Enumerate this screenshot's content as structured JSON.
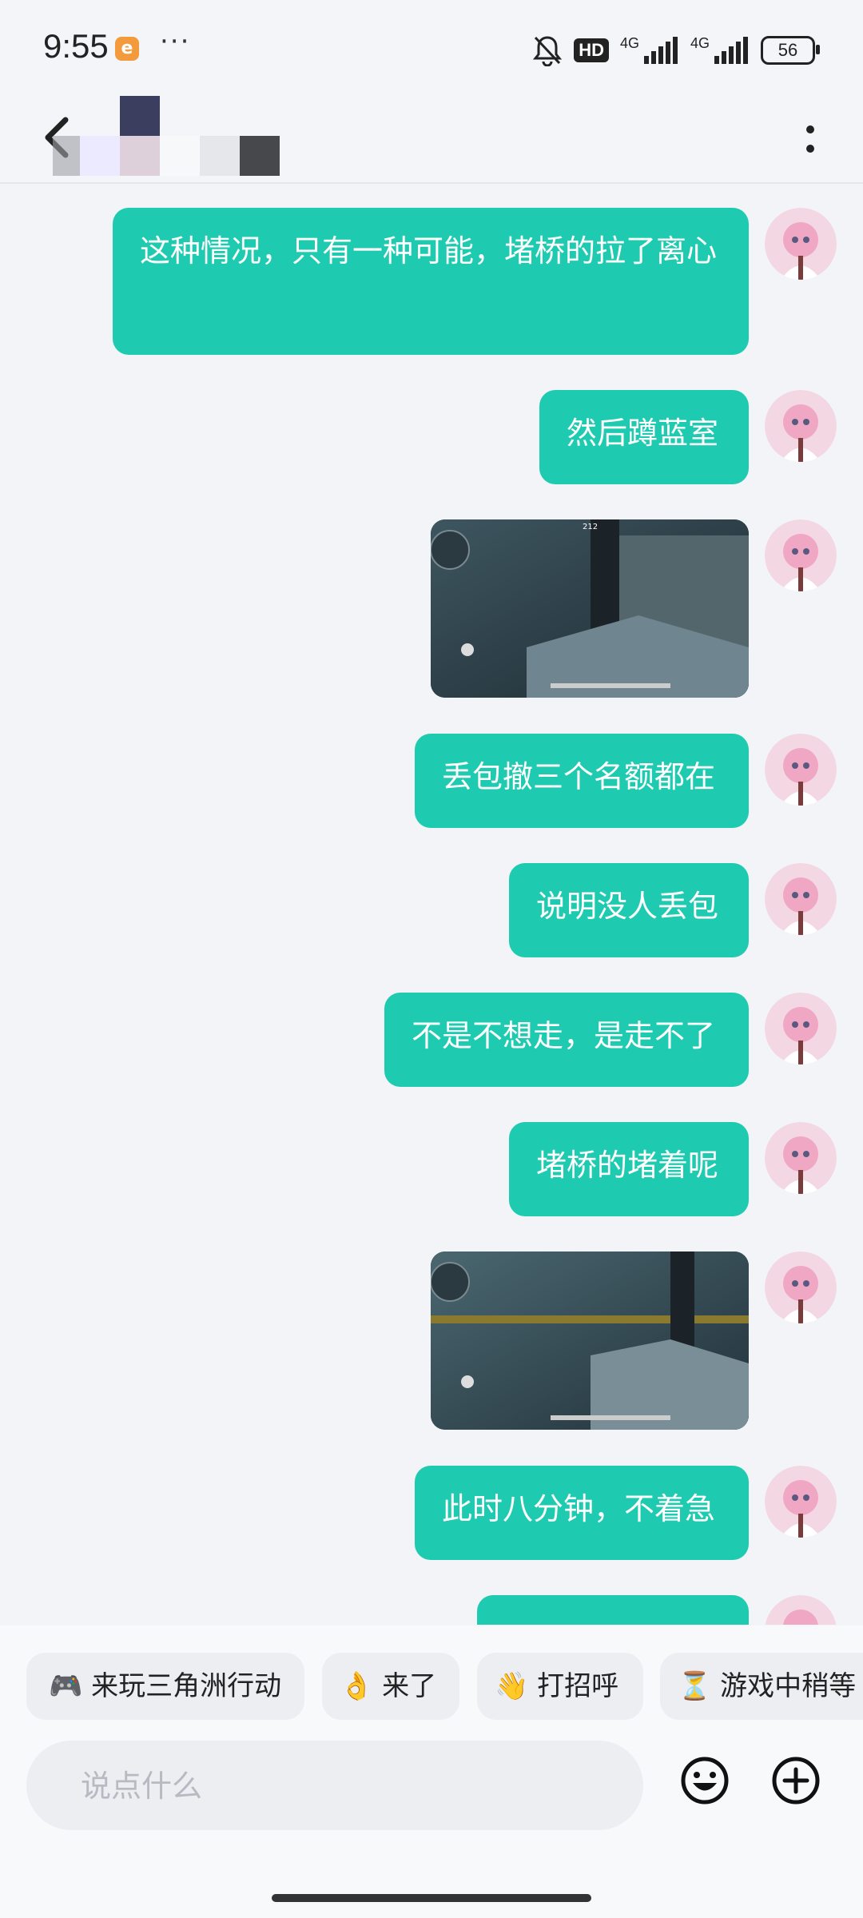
{
  "status_bar": {
    "time": "9:55",
    "notification_badge": "e",
    "more": "···",
    "hd_label": "HD",
    "network_1": "4G",
    "network_2": "4G",
    "battery": "56"
  },
  "header": {
    "title_obscured": true
  },
  "messages": [
    {
      "type": "text",
      "text": "这种情况，只有一种可能，堵桥的拉了离心"
    },
    {
      "type": "text",
      "text": "然后蹲蓝室"
    },
    {
      "type": "image",
      "icon": "game-screenshot"
    },
    {
      "type": "text",
      "text": "丢包撤三个名额都在"
    },
    {
      "type": "text",
      "text": "说明没人丢包"
    },
    {
      "type": "text",
      "text": "不是不想走，是走不了"
    },
    {
      "type": "text",
      "text": "堵桥的堵着呢"
    },
    {
      "type": "image",
      "icon": "game-screenshot"
    },
    {
      "type": "text",
      "text": "此时八分钟，不着急"
    }
  ],
  "quick_replies": [
    {
      "icon": "🎮",
      "label": "来玩三角洲行动"
    },
    {
      "icon": "👌",
      "label": "来了"
    },
    {
      "icon": "👋",
      "label": "打招呼"
    },
    {
      "icon": "⏳",
      "label": "游戏中稍等"
    }
  ],
  "input": {
    "placeholder": "说点什么",
    "value": ""
  },
  "colors": {
    "bubble": "#1fcbb0",
    "background": "#f3f4f8"
  }
}
